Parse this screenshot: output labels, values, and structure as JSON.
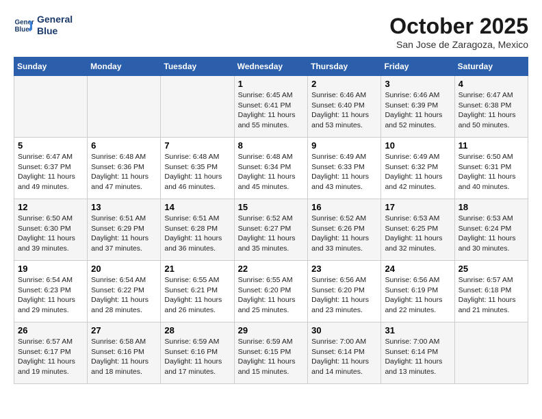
{
  "header": {
    "logo_line1": "General",
    "logo_line2": "Blue",
    "month": "October 2025",
    "location": "San Jose de Zaragoza, Mexico"
  },
  "days_of_week": [
    "Sunday",
    "Monday",
    "Tuesday",
    "Wednesday",
    "Thursday",
    "Friday",
    "Saturday"
  ],
  "weeks": [
    [
      {
        "day": "",
        "content": ""
      },
      {
        "day": "",
        "content": ""
      },
      {
        "day": "",
        "content": ""
      },
      {
        "day": "1",
        "content": "Sunrise: 6:45 AM\nSunset: 6:41 PM\nDaylight: 11 hours\nand 55 minutes."
      },
      {
        "day": "2",
        "content": "Sunrise: 6:46 AM\nSunset: 6:40 PM\nDaylight: 11 hours\nand 53 minutes."
      },
      {
        "day": "3",
        "content": "Sunrise: 6:46 AM\nSunset: 6:39 PM\nDaylight: 11 hours\nand 52 minutes."
      },
      {
        "day": "4",
        "content": "Sunrise: 6:47 AM\nSunset: 6:38 PM\nDaylight: 11 hours\nand 50 minutes."
      }
    ],
    [
      {
        "day": "5",
        "content": "Sunrise: 6:47 AM\nSunset: 6:37 PM\nDaylight: 11 hours\nand 49 minutes."
      },
      {
        "day": "6",
        "content": "Sunrise: 6:48 AM\nSunset: 6:36 PM\nDaylight: 11 hours\nand 47 minutes."
      },
      {
        "day": "7",
        "content": "Sunrise: 6:48 AM\nSunset: 6:35 PM\nDaylight: 11 hours\nand 46 minutes."
      },
      {
        "day": "8",
        "content": "Sunrise: 6:48 AM\nSunset: 6:34 PM\nDaylight: 11 hours\nand 45 minutes."
      },
      {
        "day": "9",
        "content": "Sunrise: 6:49 AM\nSunset: 6:33 PM\nDaylight: 11 hours\nand 43 minutes."
      },
      {
        "day": "10",
        "content": "Sunrise: 6:49 AM\nSunset: 6:32 PM\nDaylight: 11 hours\nand 42 minutes."
      },
      {
        "day": "11",
        "content": "Sunrise: 6:50 AM\nSunset: 6:31 PM\nDaylight: 11 hours\nand 40 minutes."
      }
    ],
    [
      {
        "day": "12",
        "content": "Sunrise: 6:50 AM\nSunset: 6:30 PM\nDaylight: 11 hours\nand 39 minutes."
      },
      {
        "day": "13",
        "content": "Sunrise: 6:51 AM\nSunset: 6:29 PM\nDaylight: 11 hours\nand 37 minutes."
      },
      {
        "day": "14",
        "content": "Sunrise: 6:51 AM\nSunset: 6:28 PM\nDaylight: 11 hours\nand 36 minutes."
      },
      {
        "day": "15",
        "content": "Sunrise: 6:52 AM\nSunset: 6:27 PM\nDaylight: 11 hours\nand 35 minutes."
      },
      {
        "day": "16",
        "content": "Sunrise: 6:52 AM\nSunset: 6:26 PM\nDaylight: 11 hours\nand 33 minutes."
      },
      {
        "day": "17",
        "content": "Sunrise: 6:53 AM\nSunset: 6:25 PM\nDaylight: 11 hours\nand 32 minutes."
      },
      {
        "day": "18",
        "content": "Sunrise: 6:53 AM\nSunset: 6:24 PM\nDaylight: 11 hours\nand 30 minutes."
      }
    ],
    [
      {
        "day": "19",
        "content": "Sunrise: 6:54 AM\nSunset: 6:23 PM\nDaylight: 11 hours\nand 29 minutes."
      },
      {
        "day": "20",
        "content": "Sunrise: 6:54 AM\nSunset: 6:22 PM\nDaylight: 11 hours\nand 28 minutes."
      },
      {
        "day": "21",
        "content": "Sunrise: 6:55 AM\nSunset: 6:21 PM\nDaylight: 11 hours\nand 26 minutes."
      },
      {
        "day": "22",
        "content": "Sunrise: 6:55 AM\nSunset: 6:20 PM\nDaylight: 11 hours\nand 25 minutes."
      },
      {
        "day": "23",
        "content": "Sunrise: 6:56 AM\nSunset: 6:20 PM\nDaylight: 11 hours\nand 23 minutes."
      },
      {
        "day": "24",
        "content": "Sunrise: 6:56 AM\nSunset: 6:19 PM\nDaylight: 11 hours\nand 22 minutes."
      },
      {
        "day": "25",
        "content": "Sunrise: 6:57 AM\nSunset: 6:18 PM\nDaylight: 11 hours\nand 21 minutes."
      }
    ],
    [
      {
        "day": "26",
        "content": "Sunrise: 6:57 AM\nSunset: 6:17 PM\nDaylight: 11 hours\nand 19 minutes."
      },
      {
        "day": "27",
        "content": "Sunrise: 6:58 AM\nSunset: 6:16 PM\nDaylight: 11 hours\nand 18 minutes."
      },
      {
        "day": "28",
        "content": "Sunrise: 6:59 AM\nSunset: 6:16 PM\nDaylight: 11 hours\nand 17 minutes."
      },
      {
        "day": "29",
        "content": "Sunrise: 6:59 AM\nSunset: 6:15 PM\nDaylight: 11 hours\nand 15 minutes."
      },
      {
        "day": "30",
        "content": "Sunrise: 7:00 AM\nSunset: 6:14 PM\nDaylight: 11 hours\nand 14 minutes."
      },
      {
        "day": "31",
        "content": "Sunrise: 7:00 AM\nSunset: 6:14 PM\nDaylight: 11 hours\nand 13 minutes."
      },
      {
        "day": "",
        "content": ""
      }
    ]
  ]
}
